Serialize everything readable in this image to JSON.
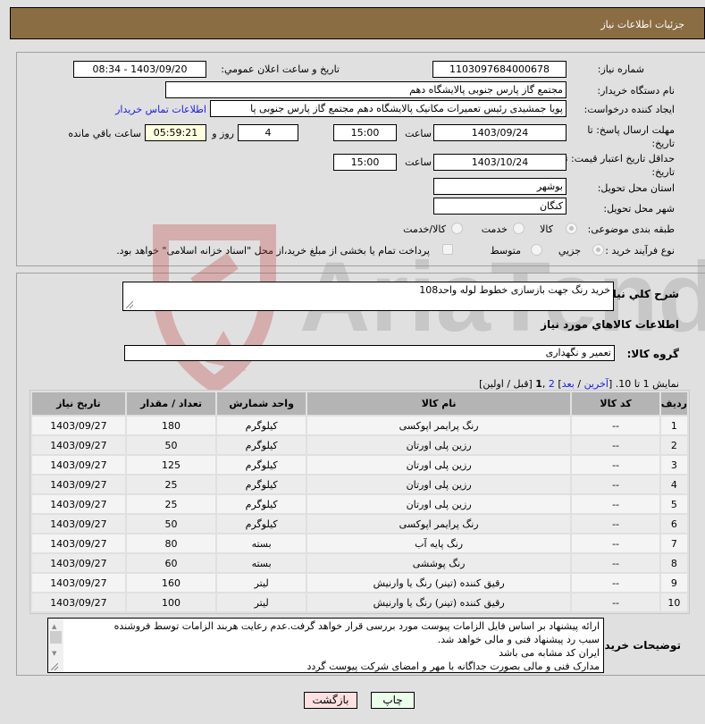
{
  "header": {
    "title": "جزئیات اطلاعات نیاز"
  },
  "form": {
    "need_number": {
      "label": "شماره نیاز:",
      "value": "1103097684000678"
    },
    "announce_datetime": {
      "label": "تاريخ و ساعت اعلان عمومي:",
      "value": "1403/09/20 - 08:34"
    },
    "buyer_org": {
      "label": "نام دستگاه خریدار:",
      "value": "مجتمع گاز پارس جنوبی  پالایشگاه دهم"
    },
    "requester": {
      "label": "ایجاد کننده درخواست:",
      "value": "پویا جمشیدی رئیس تعمیرات مکانیک پالایشگاه دهم  مجتمع گاز پارس جنوبی  پا",
      "contact_link": "اطلاعات تماس خریدار"
    },
    "reply_deadline": {
      "label": "مهلت ارسال پاسخ: تا تاریخ:",
      "date": "1403/09/24",
      "time_label": "ساعت",
      "time": "15:00",
      "days": "4",
      "days_label": "روز و",
      "remaining": "05:59:21",
      "remaining_label": "ساعت باقي مانده"
    },
    "price_validity": {
      "label": "حداقل تاریخ اعتبار قیمت: تا تاریخ:",
      "date": "1403/10/24",
      "time_label": "ساعت",
      "time": "15:00"
    },
    "province": {
      "label": "استان محل تحویل:",
      "value": "بوشهر"
    },
    "city": {
      "label": "شهر محل تحویل:",
      "value": "کنگان"
    },
    "category": {
      "label": "طبقه بندی موضوعی:",
      "options": [
        {
          "label": "کالا",
          "checked": true
        },
        {
          "label": "خدمت",
          "checked": false
        },
        {
          "label": "کالا/خدمت",
          "checked": false
        }
      ]
    },
    "purchase_type": {
      "label": "نوع فرآیند خرید :",
      "options": [
        {
          "label": "جزیي",
          "checked": true
        },
        {
          "label": "متوسط",
          "checked": false
        }
      ],
      "treasury_checkbox": {
        "label": "پرداخت تمام یا بخشی از مبلغ خرید،از محل \"اسناد خزانه اسلامی\" خواهد بود.",
        "checked": false
      }
    }
  },
  "details": {
    "description": {
      "label": "شرح کلي نياز:",
      "value": "خرید رنگ جهت بازسازی خطوط لوله واحد108"
    },
    "items_section_title": "اطلاعات کالاهاي مورد نياز",
    "goods_group": {
      "label": "گروه کالا:",
      "value": "تعمیر و نگهداری"
    },
    "pagination": {
      "prefix": "نمایش 1 تا 10. [",
      "last": "آخرین",
      "sep1": " / ",
      "next": "بعد",
      "close": "] ",
      "page2": "2",
      "comma": " ,",
      "page1": "1",
      "tail": " [قبل / اولین]"
    },
    "table": {
      "headers": [
        "ردیف",
        "کد کالا",
        "نام کالا",
        "واحد شمارش",
        "تعداد / مقدار",
        "تاریخ نیاز"
      ],
      "rows": [
        [
          "1",
          "--",
          "رنگ پرایمر اپوکسی",
          "کیلوگرم",
          "180",
          "1403/09/27"
        ],
        [
          "2",
          "--",
          "رزین پلی اورتان",
          "کیلوگرم",
          "50",
          "1403/09/27"
        ],
        [
          "3",
          "--",
          "رزین پلی اورتان",
          "کیلوگرم",
          "125",
          "1403/09/27"
        ],
        [
          "4",
          "--",
          "رزین پلی اورتان",
          "کیلوگرم",
          "25",
          "1403/09/27"
        ],
        [
          "5",
          "--",
          "رزین پلی اورتان",
          "کیلوگرم",
          "25",
          "1403/09/27"
        ],
        [
          "6",
          "--",
          "رنگ پرایمر اپوکسی",
          "کیلوگرم",
          "50",
          "1403/09/27"
        ],
        [
          "7",
          "--",
          "رنگ پایه آب",
          "بسته",
          "80",
          "1403/09/27"
        ],
        [
          "8",
          "--",
          "رنگ پوششی",
          "بسته",
          "60",
          "1403/09/27"
        ],
        [
          "9",
          "--",
          "رقیق کننده (تینر) رنگ یا وارنیش",
          "لیتر",
          "160",
          "1403/09/27"
        ],
        [
          "10",
          "--",
          "رقیق کننده (تینر) رنگ یا وارنیش",
          "لیتر",
          "100",
          "1403/09/27"
        ]
      ]
    },
    "buyer_notes": {
      "label": "توضیحات خریدار:",
      "lines": [
        "ارائه پیشنهاد بر اساس فایل الزامات پیوست مورد بررسی قرار خواهد گرفت.عدم رعایت هربند الزامات توسط فروشنده",
        "سبب رد پیشنهاد فنی و مالی خواهد شد.",
        "ایران کد مشابه می باشد",
        "مدارک فنی و مالی بصورت جداگانه با مهر و امضای شرکت پیوست گردد"
      ]
    }
  },
  "buttons": {
    "print": "چاپ",
    "back": "بازگشت"
  },
  "watermark": {
    "text": "AriaTender.neT",
    "color": "#c0504d"
  }
}
